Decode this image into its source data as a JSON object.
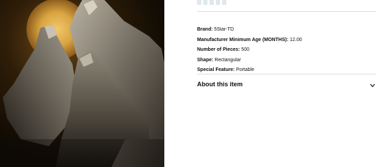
{
  "product": {
    "image_alt": "wolves-howling-at-moon-puzzle-image",
    "attributes": [
      {
        "label": "Brand:",
        "value": "5Star-TD"
      },
      {
        "label": "Manufacturer Minimum Age (MONTHS):",
        "value": "12.00"
      },
      {
        "label": "Number of Pieces:",
        "value": "500"
      },
      {
        "label": "Shape:",
        "value": "Rectangular"
      },
      {
        "label": "Special Feature:",
        "value": "Portable"
      }
    ]
  },
  "about": {
    "title": "About this item",
    "icon": "chevron-down-icon"
  },
  "colors": {
    "text": "#0f1111",
    "divider": "#dddddd",
    "moon": "#d9a441",
    "image_background": "#1a1206"
  }
}
